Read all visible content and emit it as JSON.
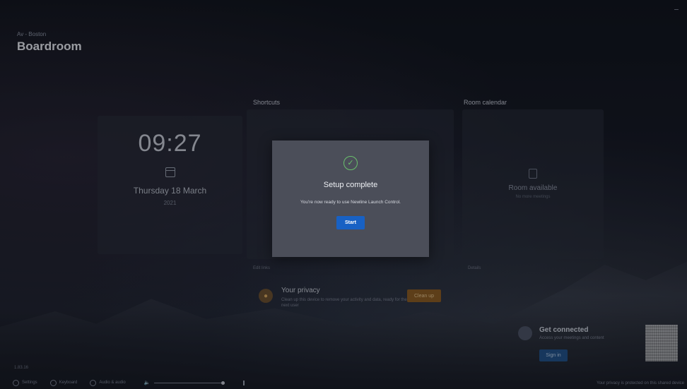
{
  "header": {
    "location": "Av - Boston",
    "room_name": "Boardroom"
  },
  "clock": {
    "time": "09:27",
    "date": "Thursday 18 March",
    "year": "2021"
  },
  "shortcuts": {
    "title": "Shortcuts",
    "footer": "Edit links"
  },
  "room_calendar": {
    "title": "Room calendar",
    "status": "Room available",
    "sub": "No more meetings",
    "footer": "Details"
  },
  "privacy": {
    "title": "Your privacy",
    "description": "Clean up this device to remove your activity and data, ready for the next user",
    "button_label": "Clean up"
  },
  "connect": {
    "title": "Get connected",
    "description": "Access your meetings and content",
    "button_label": "Sign in"
  },
  "version": "1.83.16",
  "bottom_bar": {
    "settings_label": "Settings",
    "keyboard_label": "Keyboard",
    "audio_label": "Audio & audio",
    "privacy_note": "Your privacy is protected on this shared device"
  },
  "volume": {
    "level": 1.0
  },
  "dialog": {
    "title": "Setup complete",
    "message": "You're now ready to use Newline Launch Control.",
    "button_label": "Start"
  },
  "colors": {
    "accent": "#1861c4",
    "success": "#6ac16c",
    "privacy_accent": "#8a5a1e"
  },
  "icons": {
    "check": "check-circle-icon",
    "calendar": "calendar-icon",
    "privacy": "shield-icon",
    "connect": "user-icon",
    "settings": "gear-icon",
    "keyboard": "keyboard-icon",
    "audio": "audio-icon",
    "volume": "speaker-icon",
    "mic": "mic-icon"
  }
}
